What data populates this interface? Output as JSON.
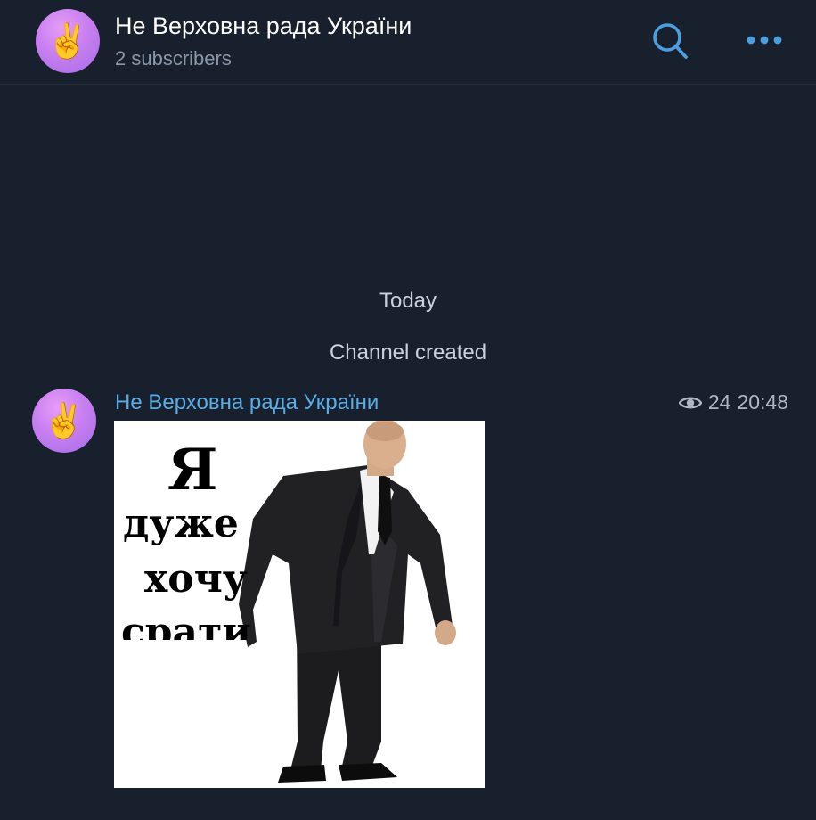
{
  "header": {
    "avatar_emoji": "✌️",
    "title": "Не Верховна рада України",
    "subtitle": "2 subscribers",
    "search_icon": "search-icon",
    "more_icon": "more-horizontal-icon",
    "accent_color": "#4a9fe0"
  },
  "chat": {
    "date_label": "Today",
    "service_message": "Channel created"
  },
  "post": {
    "avatar_emoji": "✌️",
    "author": "Не Верховна рада України",
    "views_icon": "eye-icon",
    "views": "24",
    "time": "20:48",
    "image": {
      "caption_lines": [
        "Я",
        "дуже",
        "хочу",
        "срати"
      ],
      "depicted": "man-in-suit"
    }
  },
  "colors": {
    "background": "#18202d",
    "author_name": "#5aaee6",
    "secondary_text": "#8a97a8",
    "avatar": "#c77ff0"
  }
}
